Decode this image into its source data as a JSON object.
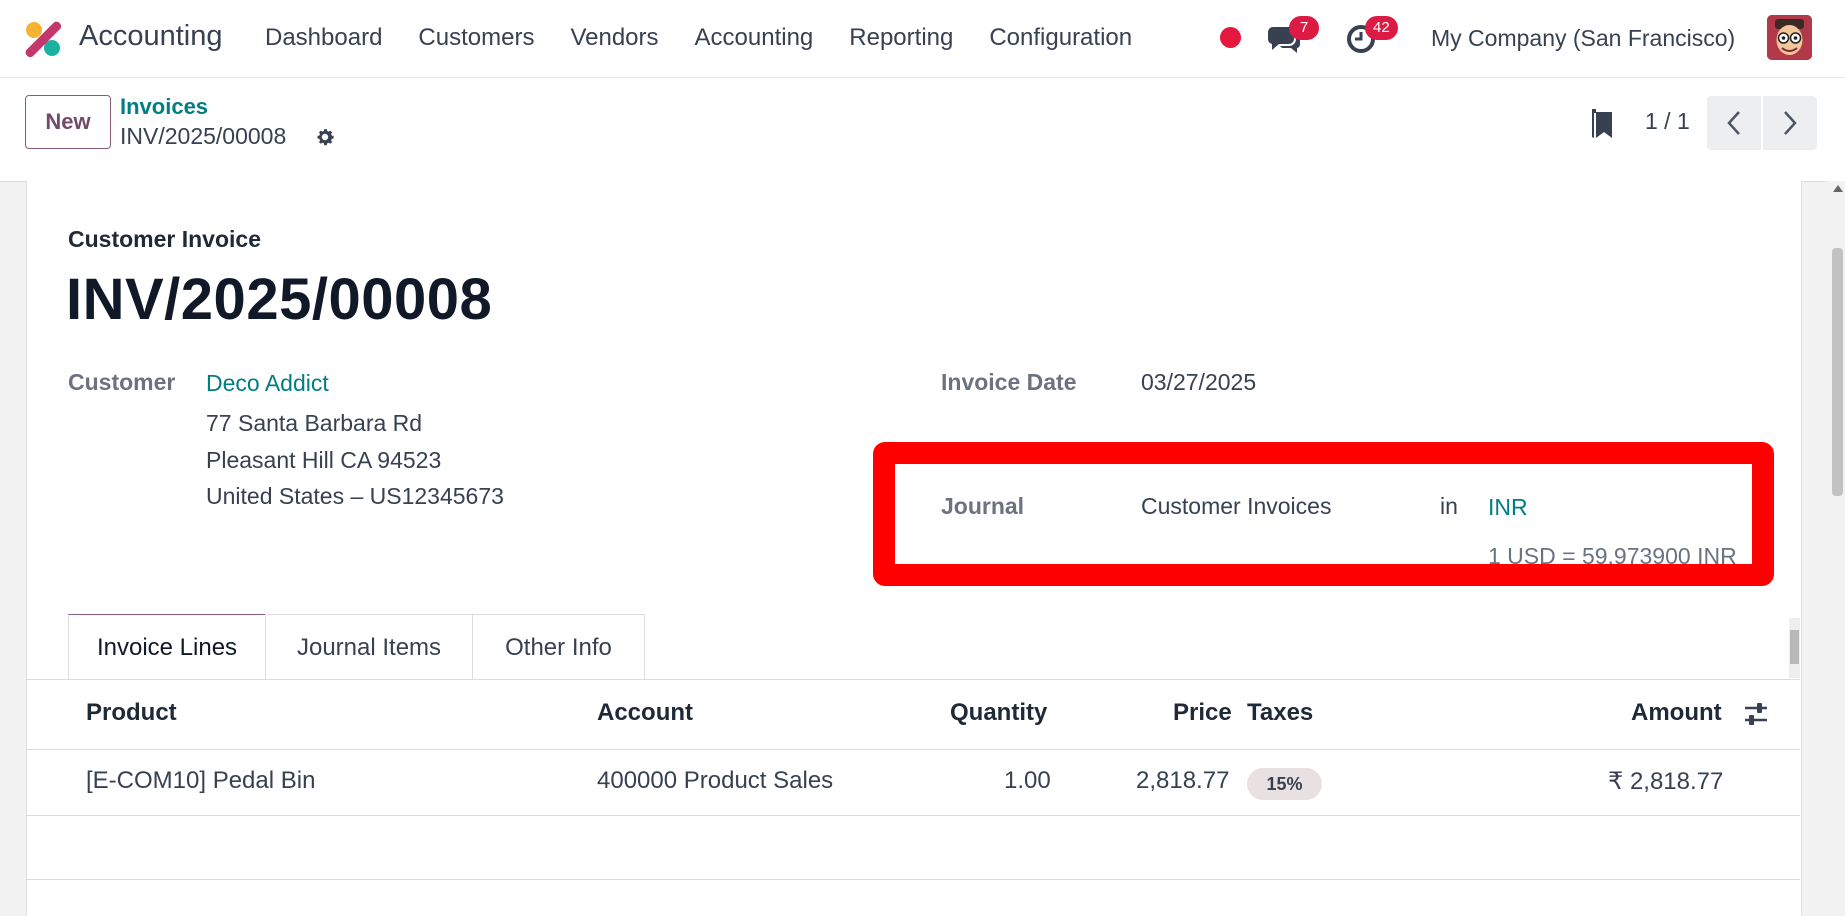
{
  "app": {
    "name": "Accounting"
  },
  "nav": [
    "Dashboard",
    "Customers",
    "Vendors",
    "Accounting",
    "Reporting",
    "Configuration"
  ],
  "systray": {
    "messages_count": "7",
    "activities_count": "42",
    "company": "My Company (San Francisco)"
  },
  "control": {
    "new_label": "New",
    "breadcrumb_parent": "Invoices",
    "breadcrumb_current": "INV/2025/00008",
    "pager": "1 / 1"
  },
  "form": {
    "doc_type": "Customer Invoice",
    "doc_name": "INV/2025/00008",
    "customer_label": "Customer",
    "customer_name": "Deco Addict",
    "address": [
      "77 Santa Barbara Rd",
      "Pleasant Hill CA 94523",
      "United States – US12345673"
    ],
    "invoice_date_label": "Invoice Date",
    "invoice_date": "03/27/2025",
    "journal_label": "Journal",
    "journal_value": "Customer Invoices",
    "in_label": "in",
    "currency": "INR",
    "rate": "1 USD = 59.973900 INR"
  },
  "tabs": [
    "Invoice Lines",
    "Journal Items",
    "Other Info"
  ],
  "table": {
    "headers": {
      "product": "Product",
      "account": "Account",
      "quantity": "Quantity",
      "price": "Price",
      "taxes": "Taxes",
      "amount": "Amount"
    },
    "rows": [
      {
        "product": "[E-COM10] Pedal Bin",
        "account": "400000 Product Sales",
        "quantity": "1.00",
        "price": "2,818.77",
        "taxes": "15%",
        "amount": "₹ 2,818.77"
      }
    ]
  },
  "colors": {
    "brand": "#714b67",
    "link": "#017e84",
    "badge": "#dc1b45",
    "highlight": "#ff0000"
  }
}
